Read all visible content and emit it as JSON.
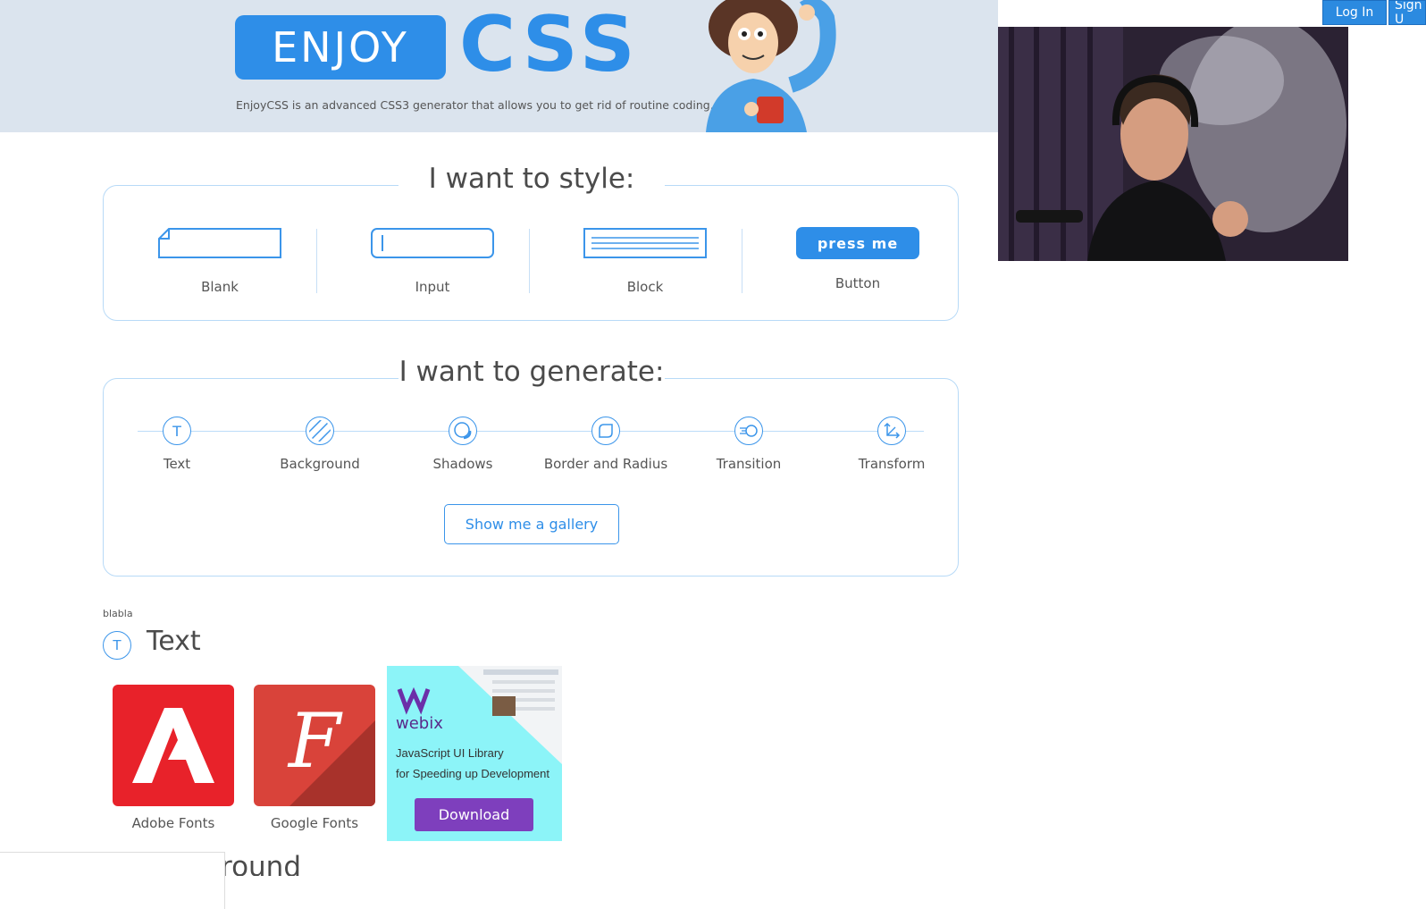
{
  "header": {
    "logo_word1": "ENJOY",
    "logo_word2": "CSS",
    "tagline": "EnjoyCSS is an advanced CSS3 generator that allows you to get rid of routine coding.",
    "login_label": "Log In",
    "signup_label": "Sign U"
  },
  "style_panel": {
    "title": "I want to style:",
    "items": [
      {
        "label": "Blank"
      },
      {
        "label": "Input"
      },
      {
        "label": "Block"
      },
      {
        "label": "Button",
        "preview": "press me"
      }
    ]
  },
  "generate_panel": {
    "title": "I want to generate:",
    "items": [
      {
        "label": "Text",
        "icon": "text-icon"
      },
      {
        "label": "Background",
        "icon": "background-icon"
      },
      {
        "label": "Shadows",
        "icon": "shadows-icon"
      },
      {
        "label": "Border and Radius",
        "icon": "border-radius-icon"
      },
      {
        "label": "Transition",
        "icon": "transition-icon"
      },
      {
        "label": "Transform",
        "icon": "transform-icon"
      }
    ],
    "gallery_button": "Show me a gallery"
  },
  "text_section": {
    "note": "blabla",
    "heading": "Text",
    "fonts": [
      {
        "label": "Adobe Fonts"
      },
      {
        "label": "Google Fonts"
      }
    ]
  },
  "ad": {
    "brand": "webix",
    "line1": "JavaScript UI Library",
    "line2": "for Speeding up Development",
    "button": "Download"
  },
  "next_section_partial": "round",
  "colors": {
    "accent": "#2e8ee8",
    "header_bg": "#dbe4ee",
    "adobe_red": "#e8222a",
    "google_red": "#d9433a",
    "ad_bg": "#8cf4f8",
    "ad_button": "#7e3fbd"
  }
}
